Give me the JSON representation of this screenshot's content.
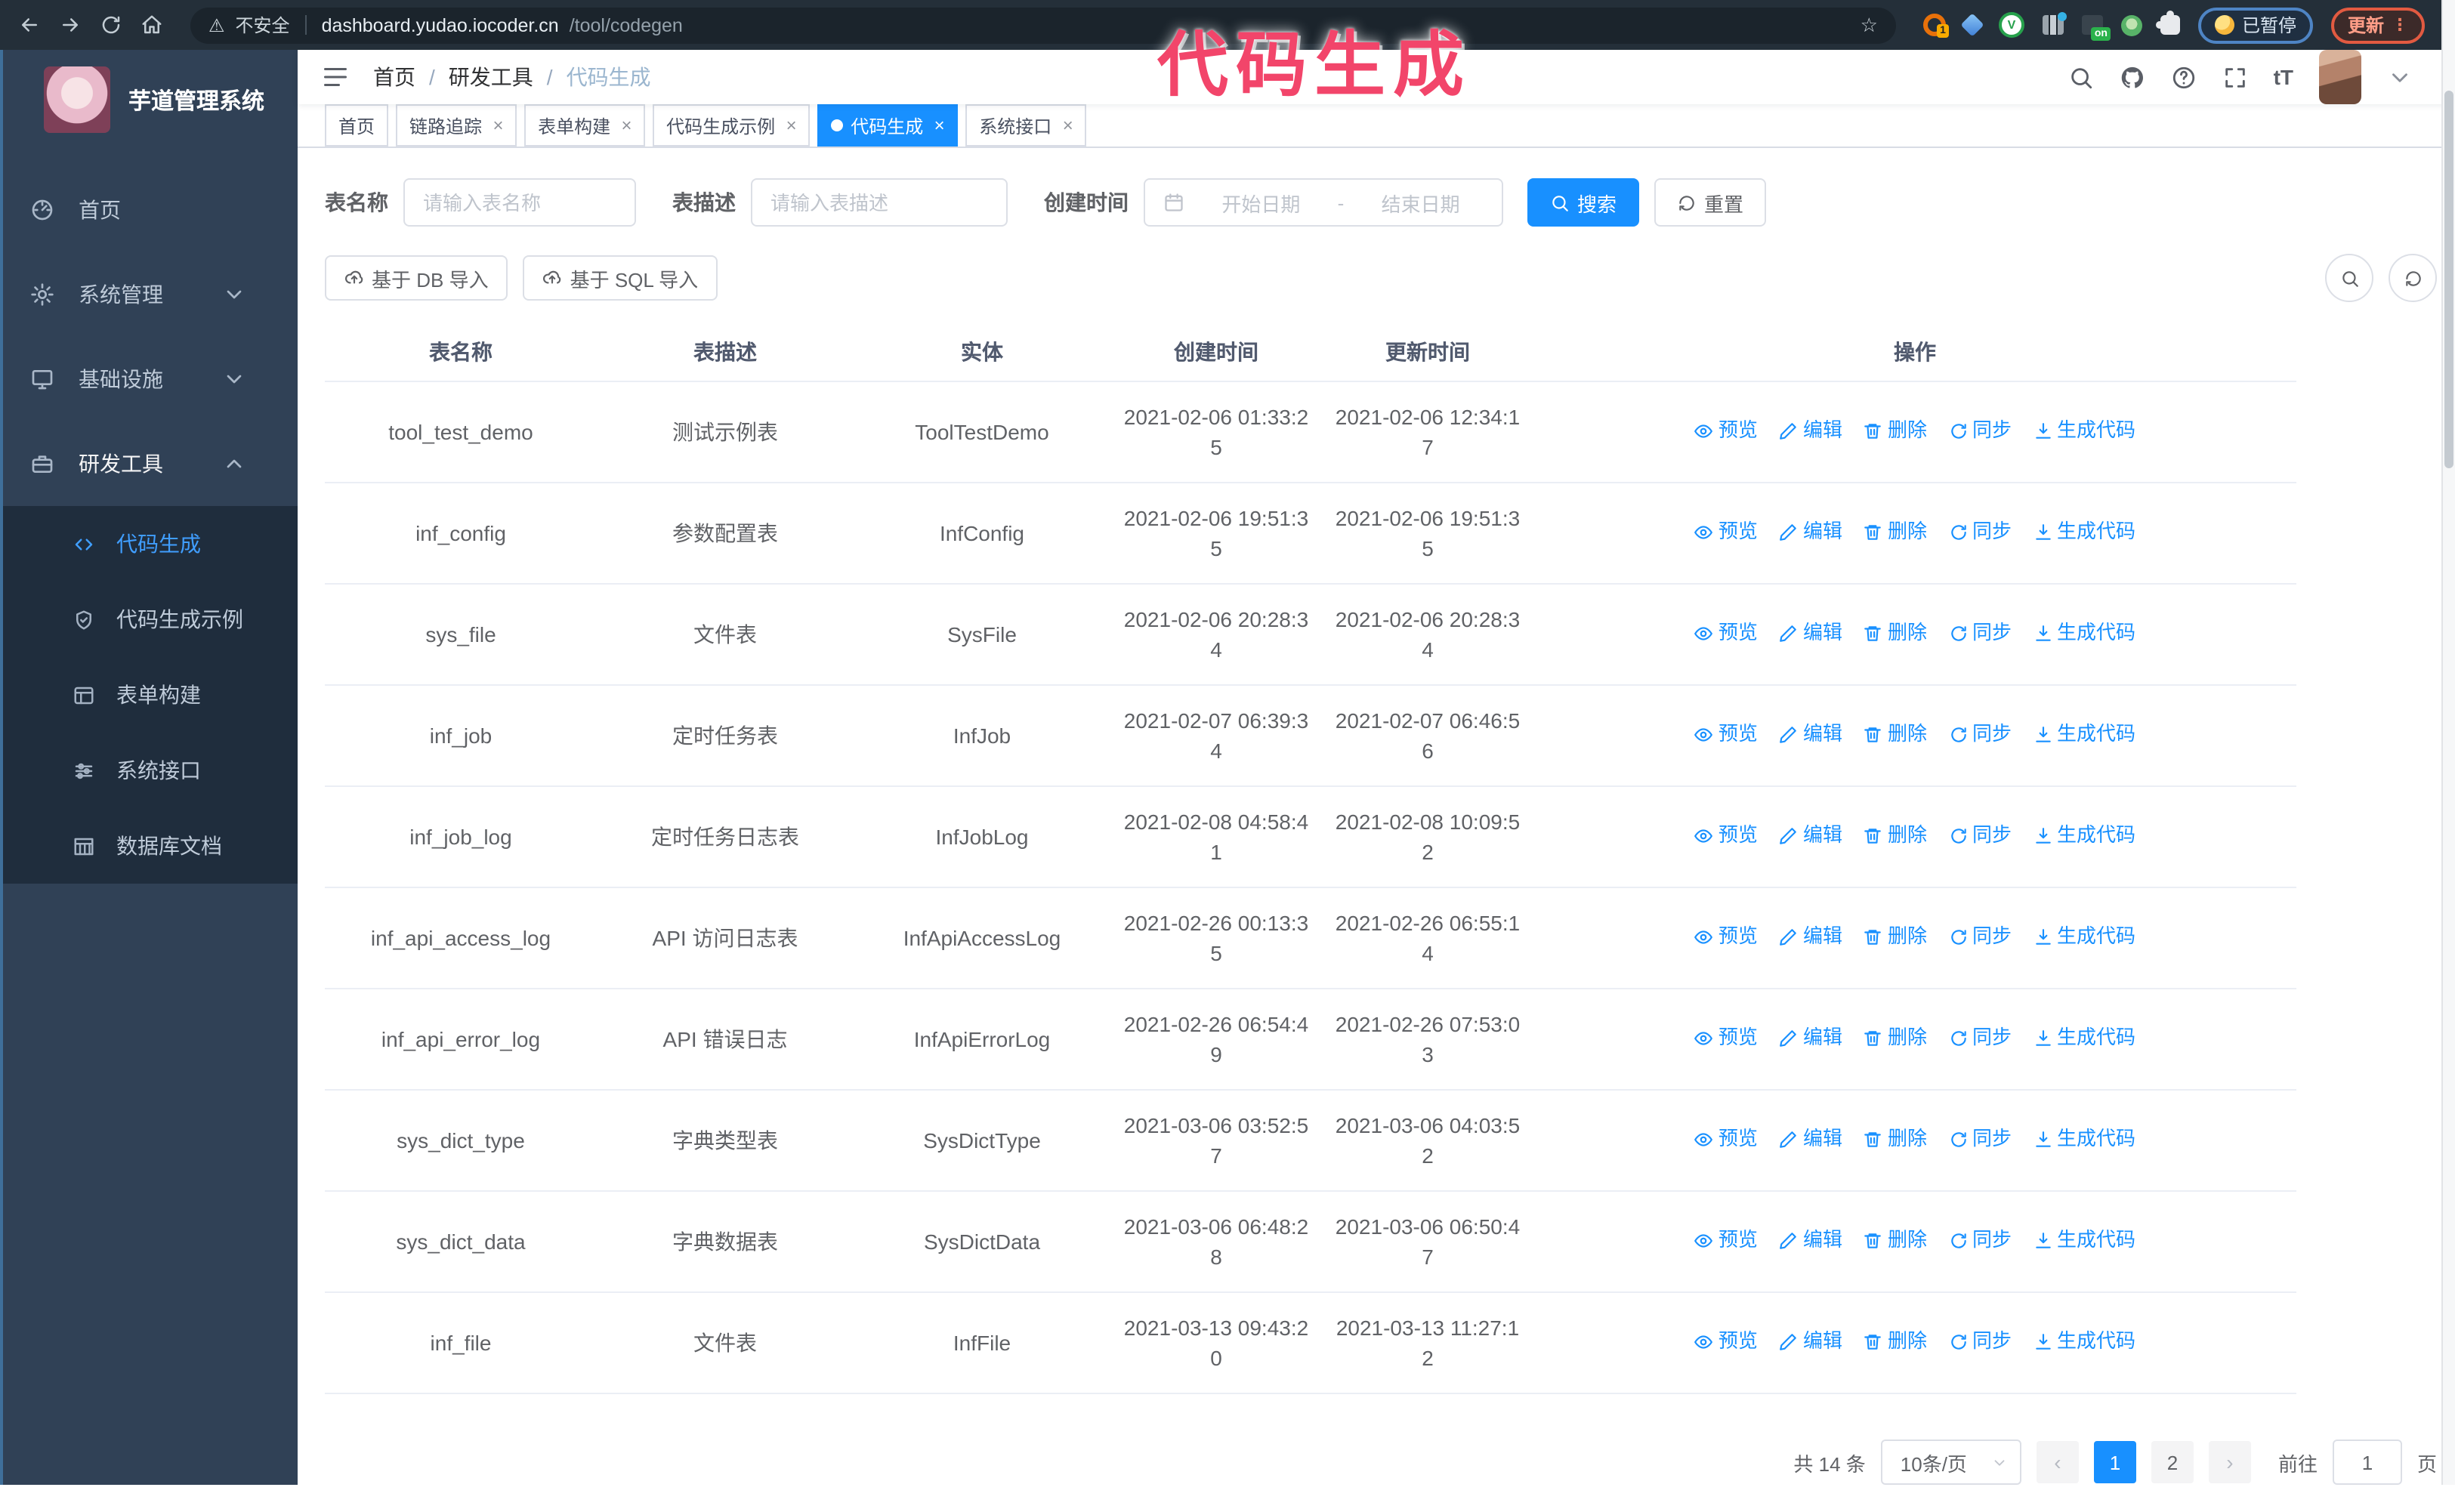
{
  "colors": {
    "accent": "#1890ff",
    "sidebar_active": "#409eff",
    "watermark": "#f2456a",
    "sidebar_bg": "#304156",
    "submenu_bg": "#1f2d3d"
  },
  "watermark": {
    "text": "代码生成"
  },
  "browser": {
    "security_label": "不安全",
    "url_host": "dashboard.yudao.iocoder.cn",
    "url_path": "/tool/codegen",
    "paused_label": "已暂停",
    "update_label": "更新",
    "extensions": [
      {
        "name": "extension-orange-ring",
        "badge": "1"
      },
      {
        "name": "extension-blue-gem"
      },
      {
        "name": "extension-green-check",
        "letter": "V"
      },
      {
        "name": "extension-columns"
      },
      {
        "name": "extension-dark-window",
        "badge": "on"
      },
      {
        "name": "extension-green-monkey"
      },
      {
        "name": "extension-puzzle"
      }
    ]
  },
  "sidebar": {
    "logo_title": "芋道管理系统",
    "menu": [
      {
        "label": "首页",
        "icon": "dashboard"
      },
      {
        "label": "系统管理",
        "icon": "gear",
        "caret": "down"
      },
      {
        "label": "基础设施",
        "icon": "monitor",
        "caret": "down"
      },
      {
        "label": "研发工具",
        "icon": "toolbox",
        "caret": "up",
        "active": true
      }
    ],
    "submenu": [
      {
        "label": "代码生成",
        "icon": "code",
        "active": true
      },
      {
        "label": "代码生成示例",
        "icon": "shield"
      },
      {
        "label": "表单构建",
        "icon": "form"
      },
      {
        "label": "系统接口",
        "icon": "sliders"
      },
      {
        "label": "数据库文档",
        "icon": "dbtable"
      }
    ]
  },
  "header": {
    "breadcrumb": [
      "首页",
      "研发工具",
      "代码生成"
    ]
  },
  "tags": [
    {
      "label": "首页",
      "closable": false,
      "active": false
    },
    {
      "label": "链路追踪",
      "closable": true,
      "active": false
    },
    {
      "label": "表单构建",
      "closable": true,
      "active": false
    },
    {
      "label": "代码生成示例",
      "closable": true,
      "active": false
    },
    {
      "label": "代码生成",
      "closable": true,
      "active": true
    },
    {
      "label": "系统接口",
      "closable": true,
      "active": false
    }
  ],
  "filters": {
    "name_label": "表名称",
    "name_placeholder": "请输入表名称",
    "desc_label": "表描述",
    "desc_placeholder": "请输入表描述",
    "date_label": "创建时间",
    "date_start_placeholder": "开始日期",
    "date_separator": "-",
    "date_end_placeholder": "结束日期",
    "search_label": "搜索",
    "reset_label": "重置"
  },
  "toolbar": {
    "import_db_label": "基于 DB 导入",
    "import_sql_label": "基于 SQL 导入"
  },
  "table": {
    "columns": [
      "表名称",
      "表描述",
      "实体",
      "创建时间",
      "更新时间",
      "操作"
    ],
    "actions": [
      {
        "label": "预览",
        "name": "preview",
        "icon": "eye"
      },
      {
        "label": "编辑",
        "name": "edit",
        "icon": "edit"
      },
      {
        "label": "删除",
        "name": "delete",
        "icon": "trash"
      },
      {
        "label": "同步",
        "name": "sync",
        "icon": "sync"
      },
      {
        "label": "生成代码",
        "name": "generate-code",
        "icon": "download"
      }
    ],
    "rows": [
      {
        "name": "tool_test_demo",
        "desc": "测试示例表",
        "entity": "ToolTestDemo",
        "created": "2021-02-06 01:33:25",
        "updated": "2021-02-06 12:34:17"
      },
      {
        "name": "inf_config",
        "desc": "参数配置表",
        "entity": "InfConfig",
        "created": "2021-02-06 19:51:35",
        "updated": "2021-02-06 19:51:35"
      },
      {
        "name": "sys_file",
        "desc": "文件表",
        "entity": "SysFile",
        "created": "2021-02-06 20:28:34",
        "updated": "2021-02-06 20:28:34"
      },
      {
        "name": "inf_job",
        "desc": "定时任务表",
        "entity": "InfJob",
        "created": "2021-02-07 06:39:34",
        "updated": "2021-02-07 06:46:56"
      },
      {
        "name": "inf_job_log",
        "desc": "定时任务日志表",
        "entity": "InfJobLog",
        "created": "2021-02-08 04:58:41",
        "updated": "2021-02-08 10:09:52"
      },
      {
        "name": "inf_api_access_log",
        "desc": "API 访问日志表",
        "entity": "InfApiAccessLog",
        "created": "2021-02-26 00:13:35",
        "updated": "2021-02-26 06:55:14"
      },
      {
        "name": "inf_api_error_log",
        "desc": "API 错误日志",
        "entity": "InfApiErrorLog",
        "created": "2021-02-26 06:54:49",
        "updated": "2021-02-26 07:53:03"
      },
      {
        "name": "sys_dict_type",
        "desc": "字典类型表",
        "entity": "SysDictType",
        "created": "2021-03-06 03:52:57",
        "updated": "2021-03-06 04:03:52"
      },
      {
        "name": "sys_dict_data",
        "desc": "字典数据表",
        "entity": "SysDictData",
        "created": "2021-03-06 06:48:28",
        "updated": "2021-03-06 06:50:47"
      },
      {
        "name": "inf_file",
        "desc": "文件表",
        "entity": "InfFile",
        "created": "2021-03-13 09:43:20",
        "updated": "2021-03-13 11:27:12"
      }
    ]
  },
  "pagination": {
    "total_label": "共 14 条",
    "page_size": "10条/页",
    "pages": [
      "1",
      "2"
    ],
    "active_page": "1",
    "prev_label": "‹",
    "next_label": "›",
    "goto_label": "前往",
    "goto_value": "1",
    "goto_unit": "页"
  }
}
